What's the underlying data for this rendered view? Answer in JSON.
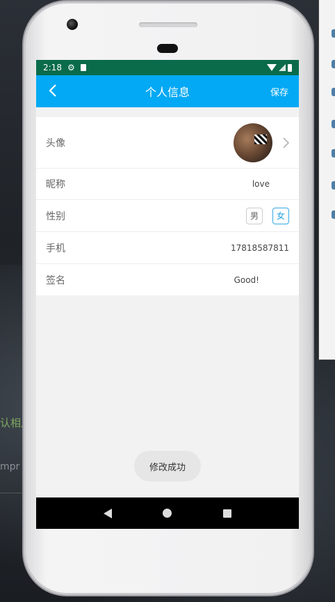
{
  "background": {
    "text_1": "认相片",
    "text_2": "mpr"
  },
  "statusbar": {
    "time": "2:18"
  },
  "appbar": {
    "title": "个人信息",
    "save_label": "保存"
  },
  "profile": {
    "avatar_label": "头像",
    "nickname_label": "昵称",
    "nickname_value": "love",
    "gender_label": "性别",
    "gender_options": [
      "男",
      "女"
    ],
    "gender_selected": "女",
    "phone_label": "手机",
    "phone_value": "17818587811",
    "signature_label": "签名",
    "signature_value": "Good!"
  },
  "toast": {
    "message": "修改成功"
  },
  "colors": {
    "statusbar": "#0a6b4b",
    "appbar": "#03a9f4",
    "accent": "#1e9ee0"
  }
}
